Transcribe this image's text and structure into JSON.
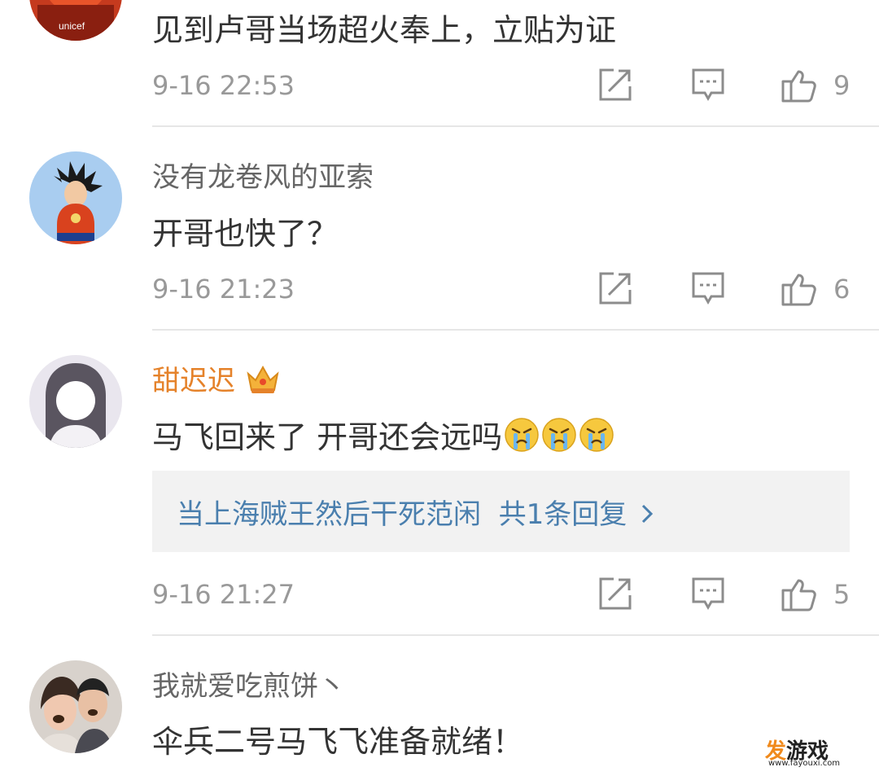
{
  "comments": [
    {
      "username": "",
      "text": "见到卢哥当场超火奉上，立贴为证",
      "time": "9-16 22:53",
      "likes": "9"
    },
    {
      "username": "没有龙卷风的亚索",
      "text": "开哥也快了？",
      "time": "9-16 21:23",
      "likes": "6"
    },
    {
      "username": "甜迟迟",
      "text": "马飞回来了 开哥还会远吗",
      "emoji_icon": "crying-face-icon",
      "reply_preview": "当上海贼王然后干死范闲",
      "reply_count": "共1条回复",
      "time": "9-16 21:27",
      "likes": "5"
    },
    {
      "username": "我就爱吃煎饼丶",
      "text": "伞兵二号马飞飞准备就绪！"
    }
  ],
  "icons": {
    "share": "share-icon",
    "reply": "comment-icon",
    "like": "thumbs-up-icon",
    "vip": "crown-icon"
  },
  "colors": {
    "vip_name": "#e5822a",
    "reply_link": "#4a7fae",
    "meta": "#999999"
  },
  "watermark": {
    "name_accent": "发",
    "name_rest": "游戏",
    "url": "www.fayouxi.com"
  }
}
